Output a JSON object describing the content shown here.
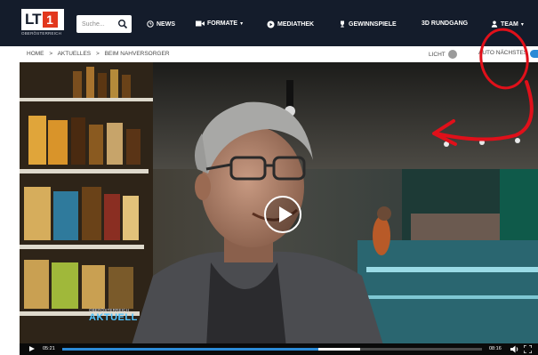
{
  "header": {
    "logo_text": "LT",
    "logo_badge": "1",
    "logo_sub": "OBERÖSTERREICH",
    "search": {
      "placeholder": "Suche..."
    },
    "nav": [
      {
        "label": "NEWS",
        "icon": "clock-icon"
      },
      {
        "label": "FORMATE",
        "icon": "camera-icon",
        "dropdown": true
      },
      {
        "label": "MEDIATHEK",
        "icon": "play-circle-icon"
      },
      {
        "label": "GEWINNSPIELE",
        "icon": "trophy-icon"
      },
      {
        "label": "3D RUNDGANG"
      },
      {
        "label": "TEAM",
        "icon": "users-icon",
        "dropdown": true
      }
    ]
  },
  "breadcrumb": {
    "items": [
      "HOME",
      "AKTUELLES",
      "BEIM NAHVERSORGER"
    ],
    "separator": ">"
  },
  "options": {
    "licht_label": "LICHT",
    "autonext_label": "AUTO NÄCHSTES"
  },
  "video": {
    "brand_small": "OBERÖSTERREICH",
    "brand_big": "AKTUELL",
    "time_current": "05:21",
    "time_total": "08:16",
    "progress": 0.61,
    "buffered": 0.71
  },
  "colors": {
    "nav_bg": "#141c2b",
    "accent_red": "#e2371d",
    "accent_blue": "#2b8ad6",
    "annotation_red": "#e0101a"
  }
}
